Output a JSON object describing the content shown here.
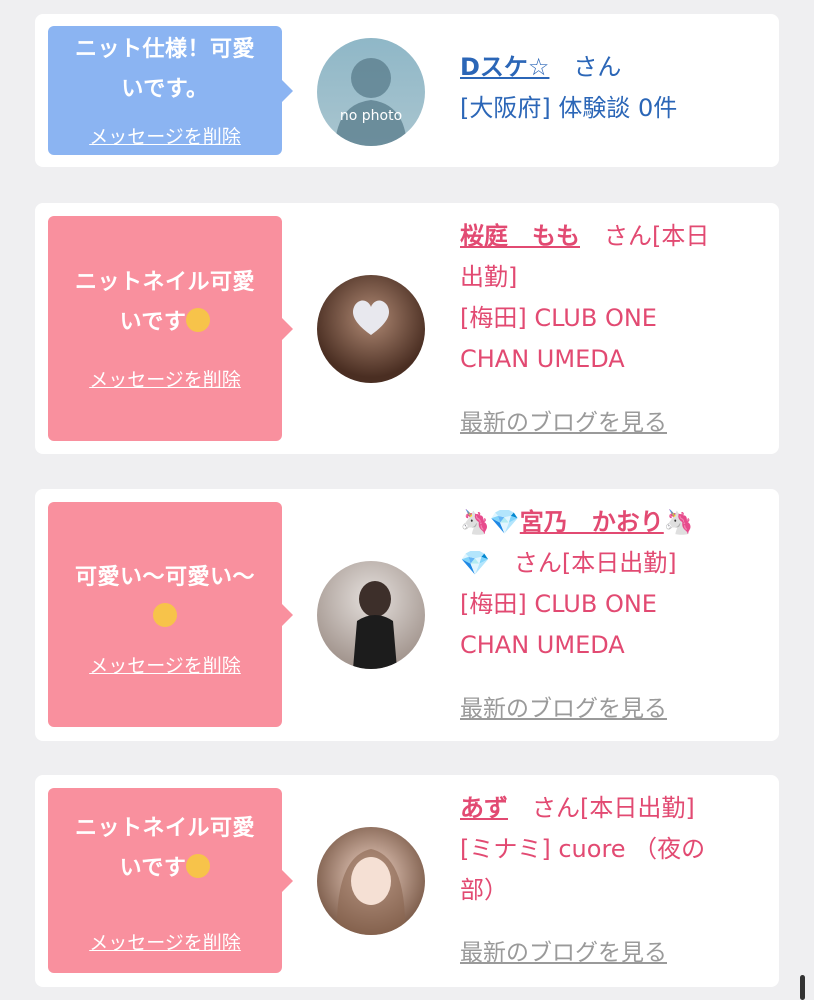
{
  "colors": {
    "blue_bubble": "#8bb4f2",
    "pink_bubble": "#f9909e",
    "pink_text": "#e24a72",
    "blue_text": "#2b66b7"
  },
  "cards": [
    {
      "message_line1": "ニット仕様！可愛",
      "message_line2": "いです。",
      "delete_label": "メッセージを削除",
      "avatar_text": "no photo",
      "name": "Dスケ☆",
      "suffix": "　さん",
      "area": "[大阪府] 体験談 0件"
    },
    {
      "message_line1": "ニットネイル可愛",
      "message_line2": "いです",
      "delete_label": "メッセージを削除",
      "name": "桜庭　もも",
      "suffix": "　さん[本日",
      "suffix2": "出勤]",
      "area1": "[梅田] CLUB ONE",
      "area2": "CHAN UMEDA",
      "blog_label": "最新のブログを見る"
    },
    {
      "message_line1": "可愛い〜可愛い〜",
      "delete_label": "メッセージを削除",
      "name": "宮乃　かおり",
      "suffix": "　さん[本日出勤]",
      "area1": "[梅田] CLUB ONE",
      "area2": "CHAN UMEDA",
      "blog_label": "最新のブログを見る"
    },
    {
      "message_line1": "ニットネイル可愛",
      "message_line2": "いです",
      "delete_label": "メッセージを削除",
      "name": "あず",
      "suffix": "　さん[本日出勤]",
      "area1": "[ミナミ] cuore （夜の",
      "area2": "部）",
      "blog_label": "最新のブログを見る"
    }
  ]
}
